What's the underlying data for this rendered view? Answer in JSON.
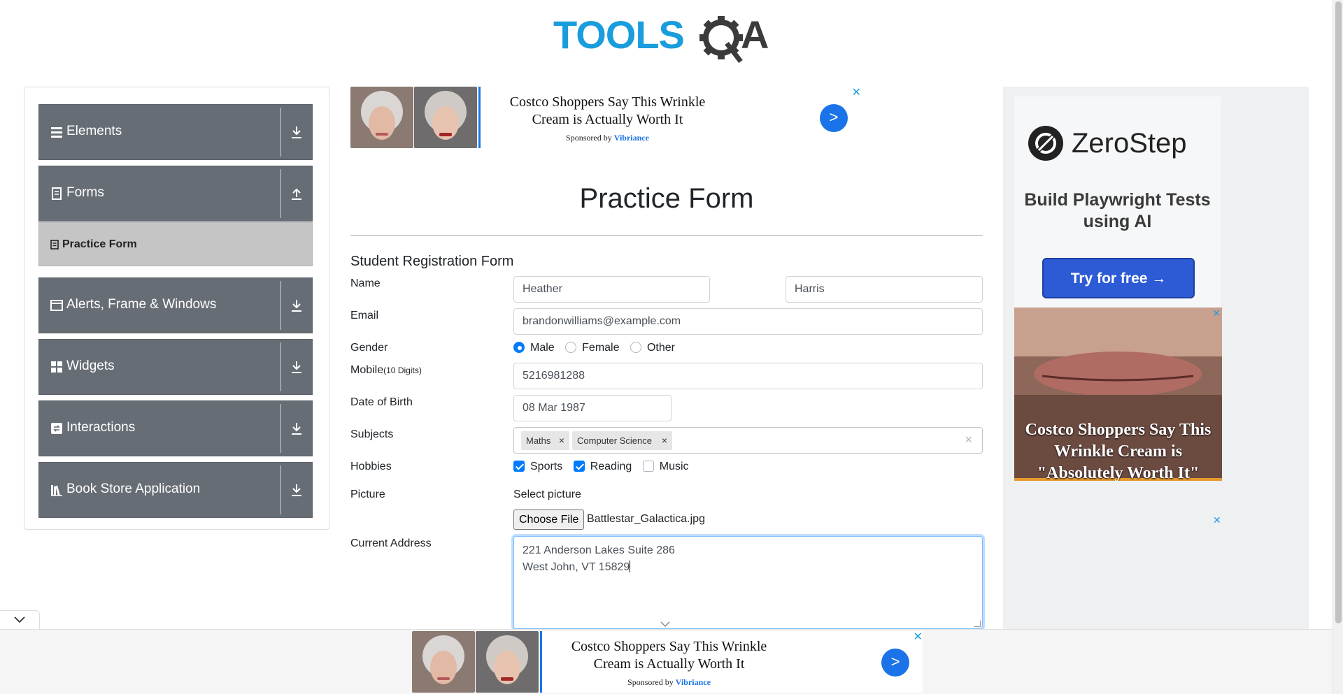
{
  "header": {
    "logo_text": "TOOLSQA"
  },
  "sidebar": {
    "groups": [
      {
        "label": "Elements",
        "icon": "hamburger-icon",
        "arrow": "download-icon"
      },
      {
        "label": "Forms",
        "icon": "document-icon",
        "arrow": "upload-icon"
      },
      {
        "label": "Alerts, Frame & Windows",
        "icon": "window-icon",
        "arrow": "download-icon"
      },
      {
        "label": "Widgets",
        "icon": "widgets-icon",
        "arrow": "download-icon"
      },
      {
        "label": "Interactions",
        "icon": "interaction-icon",
        "arrow": "download-icon"
      },
      {
        "label": "Book Store Application",
        "icon": "books-icon",
        "arrow": "download-icon"
      }
    ],
    "active_item": {
      "label": "Practice Form",
      "icon": "form-icon"
    }
  },
  "ad_top": {
    "headline": "Costco Shoppers Say This Wrinkle Cream is Actually Worth It",
    "sponsored_prefix": "Sponsored by",
    "sponsor": "Vibriance",
    "go": ">",
    "close": "✕"
  },
  "ad_bottom": {
    "headline": "Costco Shoppers Say This Wrinkle Cream is Actually Worth It",
    "sponsored_prefix": "Sponsored by",
    "sponsor": "Vibriance",
    "go": ">",
    "close": "✕"
  },
  "right_ad": {
    "brand": "ZeroStep",
    "tagline": "Build Playwright Tests using AI",
    "cta": "Try for free →",
    "lips_headline": "Costco Shoppers Say This Wrinkle Cream is \"Absolutely Worth It\"",
    "close": "✕"
  },
  "main": {
    "page_title": "Practice Form",
    "form_title": "Student Registration Form",
    "labels": {
      "name": "Name",
      "email": "Email",
      "gender": "Gender",
      "mobile": "Mobile",
      "mobile_hint": "(10 Digits)",
      "dob": "Date of Birth",
      "subjects": "Subjects",
      "hobbies": "Hobbies",
      "picture": "Picture",
      "address": "Current Address"
    },
    "first_name": "Heather",
    "last_name": "Harris",
    "email": "brandonwilliams@example.com",
    "gender_options": [
      "Male",
      "Female",
      "Other"
    ],
    "gender_selected": "Male",
    "mobile": "5216981288",
    "dob": "08 Mar 1987",
    "subjects": [
      "Maths",
      "Computer Science"
    ],
    "subject_remove": "×",
    "subjects_clear": "×",
    "hobbies": [
      {
        "label": "Sports",
        "checked": true
      },
      {
        "label": "Reading",
        "checked": true
      },
      {
        "label": "Music",
        "checked": false
      }
    ],
    "select_picture": "Select picture",
    "choose_file": "Choose File",
    "file_name": "Battlestar_Galactica.jpg",
    "address_line1": "221 Anderson Lakes Suite 286",
    "address_line2": "West John, VT 15829"
  },
  "colors": {
    "sidebar_group": "#676d75",
    "active_item": "#c5c5c5",
    "accent": "#007bff",
    "logo_blue": "#1a9ddc",
    "logo_dark": "#3b3b3b"
  }
}
